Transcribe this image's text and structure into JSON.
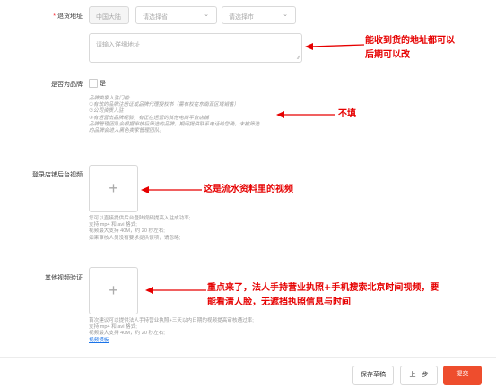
{
  "form": {
    "return_address": {
      "label": "退货地址",
      "country_value": "中国大陆",
      "province_placeholder": "请选择省",
      "city_placeholder": "请选择市",
      "detail_placeholder": "请输入详细地址"
    },
    "is_brand": {
      "label": "是否为品牌",
      "checkbox_label": "是"
    },
    "brand_hints": [
      "品牌卖家入驻门槛:",
      "①有效的品牌注册证或品牌代理授权书（需有权在东南亚区域销售）",
      "②公司资质入驻",
      "③有运营出品牌经验，有正在运营的其他电商平台店铺",
      "品牌管理团队会根据审核后筛选的品牌，期间提供联系电话给您确，未被筛选",
      "的品牌会进入黑色卖家管理团队。"
    ],
    "store_video": {
      "label": "登录店铺后台视频",
      "plus": "+",
      "hints": [
        "您可以直接提供后台登陆视频提高入驻成功率;",
        "支持 mp4 和 avi 格式;",
        "视频最大支持 40M，约 20 秒左右;",
        "如果审核人员没有要求提供该项，请忽略;"
      ]
    },
    "other_video": {
      "label": "其他视频验证",
      "plus": "+",
      "hints": [
        "首次建议可以提供法人手持营业执照+三天以内日期的视频提高审核通过率;",
        "支持 mp4 和 avi 格式;",
        "视频最大支持 40M，约 20 秒左右;"
      ],
      "example_link": "视频模板"
    }
  },
  "annotations": {
    "address_note_1": "能收到货的地址都可以",
    "address_note_2": "后期可以改",
    "brand_note": "不填",
    "store_video_note": "这是流水资料里的视频",
    "other_video_note_1": "重点来了，法人手持营业执照+手机搜索北京时间视频，要",
    "other_video_note_2": "能看清人脸，无遮挡执照信息与时间"
  },
  "footer": {
    "save_draft": "保存草稿",
    "prev_step": "上一步",
    "submit": "提交"
  },
  "colors": {
    "annotation_red": "#e60000",
    "submit_bg": "#ee4d2d",
    "required_star": "#f5222d"
  }
}
